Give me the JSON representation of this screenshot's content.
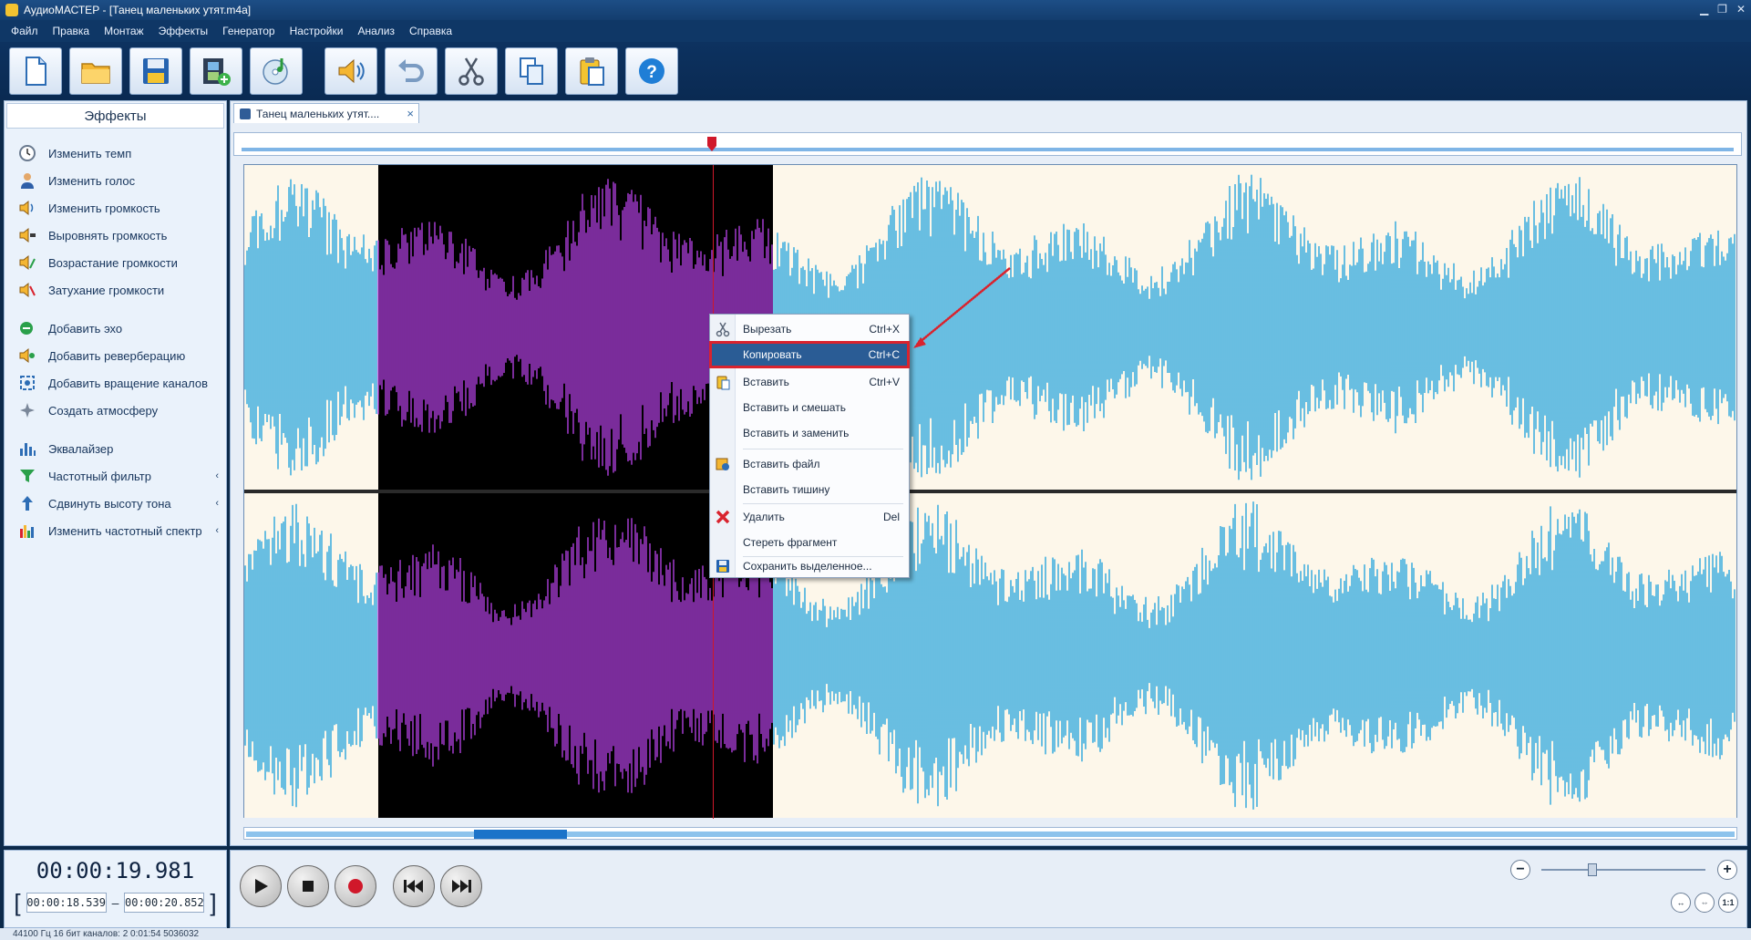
{
  "titlebar": {
    "title": "АудиоМАСТЕР - [Танец маленьких утят.m4a]"
  },
  "menu": [
    "Файл",
    "Правка",
    "Монтаж",
    "Эффекты",
    "Генератор",
    "Настройки",
    "Анализ",
    "Справка"
  ],
  "toolbar": {
    "buttons": [
      {
        "name": "new-file",
        "icon": "document-icon"
      },
      {
        "name": "open-file",
        "icon": "folder-icon"
      },
      {
        "name": "save",
        "icon": "floppy-icon"
      },
      {
        "name": "add-video",
        "icon": "film-add-icon"
      },
      {
        "name": "burn-cd",
        "icon": "cd-music-icon"
      },
      {
        "name": "volume",
        "icon": "speaker-icon"
      },
      {
        "name": "undo",
        "icon": "undo-icon"
      },
      {
        "name": "cut",
        "icon": "scissors-icon"
      },
      {
        "name": "copy",
        "icon": "copy-icon"
      },
      {
        "name": "paste",
        "icon": "paste-icon"
      },
      {
        "name": "help",
        "icon": "help-icon"
      }
    ]
  },
  "sidebar": {
    "header": "Эффекты",
    "groups": [
      [
        {
          "label": "Изменить темп",
          "icon": "clock-icon"
        },
        {
          "label": "Изменить голос",
          "icon": "user-voice-icon"
        },
        {
          "label": "Изменить громкость",
          "icon": "volume-change-icon"
        },
        {
          "label": "Выровнять громкость",
          "icon": "volume-level-icon"
        },
        {
          "label": "Возрастание громкости",
          "icon": "volume-fade-in-icon"
        },
        {
          "label": "Затухание громкости",
          "icon": "volume-fade-out-icon"
        }
      ],
      [
        {
          "label": "Добавить эхо",
          "icon": "echo-icon"
        },
        {
          "label": "Добавить реверберацию",
          "icon": "reverb-icon"
        },
        {
          "label": "Добавить вращение каналов",
          "icon": "rotate-channels-icon"
        },
        {
          "label": "Создать атмосферу",
          "icon": "atmosphere-icon"
        }
      ],
      [
        {
          "label": "Эквалайзер",
          "icon": "equalizer-icon",
          "submenu": false
        },
        {
          "label": "Частотный фильтр",
          "icon": "filter-icon",
          "submenu": true
        },
        {
          "label": "Сдвинуть высоту тона",
          "icon": "pitch-icon",
          "submenu": true
        },
        {
          "label": "Изменить частотный спектр",
          "icon": "spectrum-icon",
          "submenu": true
        }
      ]
    ],
    "submenu_arrow": "‹"
  },
  "tab": {
    "label": "Танец маленьких утят....",
    "close": "×"
  },
  "time": {
    "current": "00:00:19.981",
    "start": "00:00:18.539",
    "end": "00:00:20.852",
    "open_bracket": "[",
    "close_bracket": "]",
    "dash": "–"
  },
  "status": "44100 Гц  16 бит  каналов: 2   0:01:54 5036032",
  "context_menu": {
    "items": [
      {
        "label": "Вырезать",
        "shortcut": "Ctrl+X",
        "icon": "scissors-icon"
      },
      {
        "label": "Копировать",
        "shortcut": "Ctrl+C",
        "icon": "",
        "highlighted": true
      },
      {
        "label": "Вставить",
        "shortcut": "Ctrl+V",
        "icon": "paste-icon"
      },
      {
        "label": "Вставить и смешать",
        "shortcut": "",
        "icon": ""
      },
      {
        "label": "Вставить и заменить",
        "shortcut": "",
        "icon": ""
      },
      {
        "label": "Вставить файл",
        "shortcut": "",
        "icon": "insert-file-icon"
      },
      {
        "label": "Вставить тишину",
        "shortcut": "",
        "icon": ""
      },
      {
        "label": "Удалить",
        "shortcut": "Del",
        "icon": "delete-x-icon"
      },
      {
        "label": "Стереть фрагмент",
        "shortcut": "",
        "icon": ""
      },
      {
        "label": "Сохранить выделенное...",
        "shortcut": "",
        "icon": "save-selection-icon"
      }
    ]
  },
  "transport": {
    "buttons": [
      "play",
      "stop",
      "record",
      "rewind",
      "forward"
    ],
    "zoom_minus": "−",
    "zoom_plus": "+",
    "zoom_buttons": [
      "↔",
      "⇔",
      "1:1"
    ]
  },
  "waveform": {
    "unselected_color": "#1aa0dc",
    "selected_color": "#bb44ee",
    "selected_bg": "#000000",
    "bg": "#fdf7ea"
  }
}
